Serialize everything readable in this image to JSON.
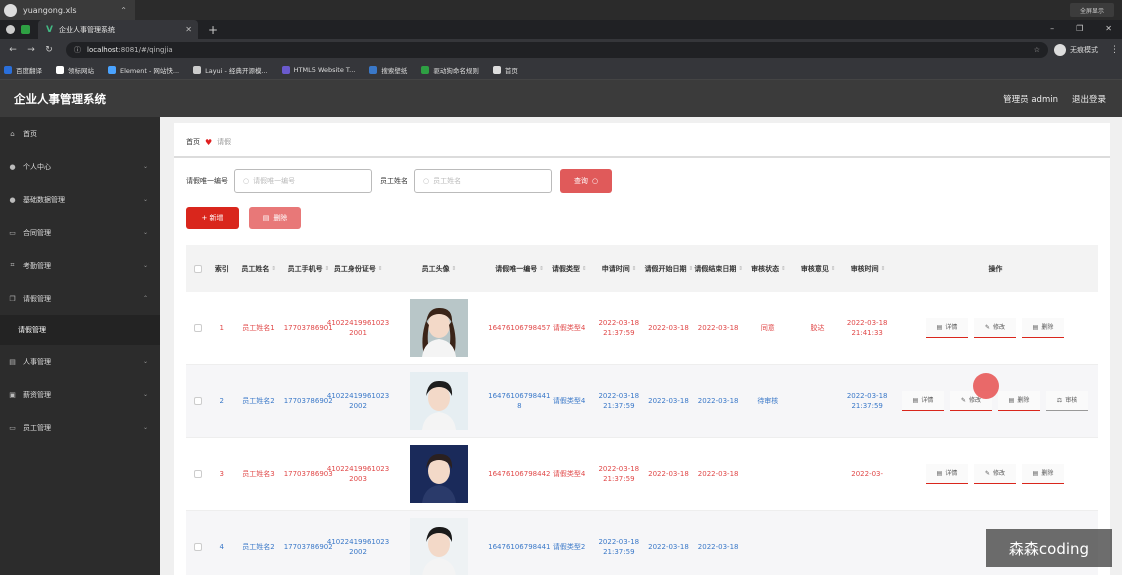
{
  "os": {
    "file_tab": "yuangong.xls",
    "fullscreen_label": "全屏显示"
  },
  "browser": {
    "tab_title": "企业人事管理系统",
    "url_host": "localhost",
    "url_rest": ":8081/#/qingjia",
    "incognito": "无痕模式",
    "bookmarks": [
      {
        "label": "百度翻译",
        "color": "#2a6fdb"
      },
      {
        "label": "领标网站",
        "color": "#ffffff"
      },
      {
        "label": "Element - 网站快...",
        "color": "#4aa3ff"
      },
      {
        "label": "Layui - 经典开源模...",
        "color": "#cccccc"
      },
      {
        "label": "HTML5 Website T...",
        "color": "#6a5acd"
      },
      {
        "label": "搜索壁纸",
        "color": "#3a78c8"
      },
      {
        "label": "驱动狗命名规则",
        "color": "#2ea043"
      },
      {
        "label": "首页",
        "color": "#dddddd"
      }
    ]
  },
  "header": {
    "title": "企业人事管理系统",
    "user": "管理员 admin",
    "logout": "退出登录"
  },
  "sidebar": {
    "items": [
      {
        "label": "首页",
        "icon": "home-icon",
        "chev": ""
      },
      {
        "label": "个人中心",
        "icon": "user-icon",
        "chev": "⌄"
      },
      {
        "label": "基础数据管理",
        "icon": "user-icon",
        "chev": "⌄"
      },
      {
        "label": "合同管理",
        "icon": "file-icon",
        "chev": "⌄"
      },
      {
        "label": "考勤管理",
        "icon": "scan-icon",
        "chev": "⌄"
      },
      {
        "label": "请假管理",
        "icon": "copy-icon",
        "chev": "⌃"
      }
    ],
    "sub_item": "请假管理",
    "items_after": [
      {
        "label": "人事管理",
        "icon": "doc-icon",
        "chev": "⌄"
      },
      {
        "label": "薪资管理",
        "icon": "wallet-icon",
        "chev": "⌄"
      },
      {
        "label": "员工管理",
        "icon": "card-icon",
        "chev": "⌄"
      }
    ]
  },
  "breadcrumb": {
    "home": "首页",
    "current": "请假"
  },
  "search": {
    "label1": "请假唯一编号",
    "placeholder1": "请假唯一编号",
    "label2": "员工姓名",
    "placeholder2": "员工姓名",
    "button": "查询"
  },
  "actions": {
    "add": "+ 新增",
    "delete": "删除"
  },
  "table": {
    "headers": [
      "索引",
      "员工姓名",
      "员工手机号",
      "员工身份证号",
      "员工头像",
      "请假唯一编号",
      "请假类型",
      "申请时间",
      "请假开始日期",
      "请假结束日期",
      "审核状态",
      "审核意见",
      "审核时间",
      "操作"
    ],
    "ops": {
      "detail": "详情",
      "edit": "修改",
      "delete": "删除",
      "audit": "审核"
    },
    "rows": [
      {
        "idx": "1",
        "name": "员工姓名1",
        "phone": "17703786901",
        "idcard": "41022419961023 2001",
        "no": "16476106798457",
        "type": "请假类型4",
        "apply": "2022-03-18 21:37:59",
        "start": "2022-03-18",
        "end": "2022-03-18",
        "status": "同意",
        "opinion": "胶达",
        "audit_time": "2022-03-18 21:41:33",
        "color": "red",
        "has_audit_btn": false
      },
      {
        "idx": "2",
        "name": "员工姓名2",
        "phone": "17703786902",
        "idcard": "41022419961023 2002",
        "no": "16476106798441 8",
        "type": "请假类型4",
        "apply": "2022-03-18 21:37:59",
        "start": "2022-03-18",
        "end": "2022-03-18",
        "status": "待审核",
        "opinion": "",
        "audit_time": "2022-03-18 21:37:59",
        "color": "blue",
        "has_audit_btn": true
      },
      {
        "idx": "3",
        "name": "员工姓名3",
        "phone": "17703786903",
        "idcard": "41022419961023 2003",
        "no": "16476106798442",
        "type": "请假类型4",
        "apply": "2022-03-18 21:37:59",
        "start": "2022-03-18",
        "end": "2022-03-18",
        "status": "",
        "opinion": "",
        "audit_time": "2022-03-",
        "color": "red",
        "has_audit_btn": false
      },
      {
        "idx": "4",
        "name": "员工姓名2",
        "phone": "17703786902",
        "idcard": "41022419961023 2002",
        "no": "16476106798441",
        "type": "请假类型2",
        "apply": "2022-03-18 21:37:59",
        "start": "2022-03-18",
        "end": "2022-03-18",
        "status": "",
        "opinion": "",
        "audit_time": "",
        "color": "blue",
        "has_audit_btn": false
      }
    ]
  },
  "watermark": "森森coding"
}
